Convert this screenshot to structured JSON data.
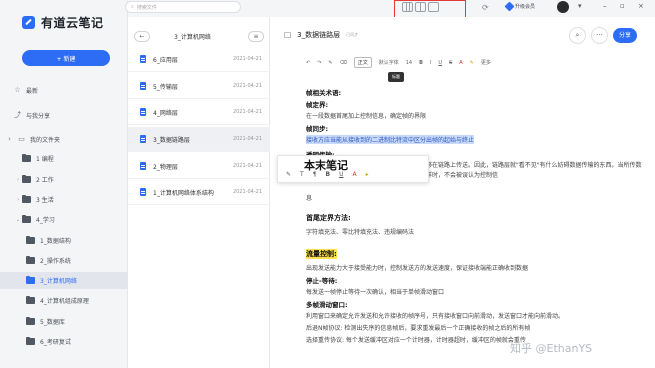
{
  "app": {
    "name": "有道云笔记",
    "new_label": "+ 新建"
  },
  "top": {
    "search_placeholder": "搜索文件",
    "vip_label": "升级会员"
  },
  "sidebar": {
    "nav": [
      {
        "label": "最新",
        "icon": "clock-icon"
      },
      {
        "label": "与我分享",
        "icon": "share-icon"
      },
      {
        "label": "我的文件夹",
        "icon": "folder-icon"
      }
    ],
    "tree": [
      {
        "label": "1 编程"
      },
      {
        "label": "2 工作"
      },
      {
        "label": "3 生活"
      },
      {
        "label": "4_学习"
      },
      {
        "label": "1_数据结构"
      },
      {
        "label": "2_操作系统"
      },
      {
        "label": "3_计算机网络"
      },
      {
        "label": "4_计算机组成原理"
      },
      {
        "label": "5_数据库"
      },
      {
        "label": "6_考研复试"
      }
    ]
  },
  "notelist": {
    "title": "3_计算机网络",
    "notes": [
      {
        "name": "6_应用层",
        "date": "2021-04-21"
      },
      {
        "name": "5_传输层",
        "date": "2021-04-21"
      },
      {
        "name": "4_网络层",
        "date": "2021-04-21"
      },
      {
        "name": "3_数据链路层",
        "date": "2021-04-21"
      },
      {
        "name": "2_物理层",
        "date": "2021-04-21"
      },
      {
        "name": "1_计算机网络体系结构",
        "date": "2021-04-21"
      }
    ]
  },
  "editor": {
    "title": "3_数据链路层",
    "subtitle": "已同步",
    "share_label": "分享",
    "toolbar": {
      "style": "正文",
      "font": "默认字体",
      "size": "14",
      "more": "更多"
    },
    "tooltip": "标题",
    "lines": [
      "帧相关术语:",
      "帧定界:",
      "在一段数据首尾加上控制信息，确定帧的界限",
      "帧同步:",
      "接收方应当能从接收到的二进制比特流中区分出帧的起始与终止",
      "透明传输:",
      "不管所传数据是什么样的比特组合，都应当能够在链路上传送。因此，链路层就\"看不见\"有什么妨碍数据传输的东西。当所传数据中的比特组合恰巧与某一个控制信息完全一样时，不会被误认为控制信",
      "息",
      "首尾定界方法:",
      "字符填充法、零比特填充法、违规编码法",
      "流量控制:",
      "出现发送能力大于接受能力时，控制发送方的发送速度，保证接收端能正确收到数据",
      "停止-等待:",
      "每发送一帧停止等待一次确认，相当于单帧滑动窗口",
      "多帧滑动窗口:",
      "利用窗口来确定允许发送和允许接收的帧序号，只有接收窗口向前滑动，发送窗口才能向前滑动。",
      "后退N帧协议: 检测出失序的信息帧后，要求重发最后一个正确接收的帧之后的所有帧",
      "选择重传协议: 每个发送缓冲区对应一个计时器，计时器超时，缓冲区的帧就会重传"
    ],
    "float_title": "本末笔记"
  },
  "watermark": "知乎 @EthanYS"
}
